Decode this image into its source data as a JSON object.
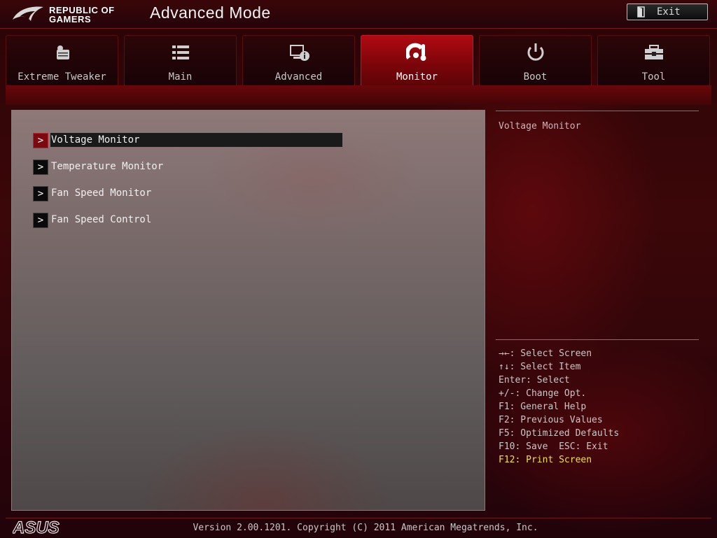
{
  "header": {
    "brand_line1": "REPUBLIC OF",
    "brand_line2": "GAMERS",
    "mode_title": "Advanced Mode",
    "exit_label": "Exit"
  },
  "tabs": [
    {
      "label": "Extreme Tweaker",
      "icon": "tweaker-icon",
      "active": false
    },
    {
      "label": "Main",
      "icon": "list-icon",
      "active": false
    },
    {
      "label": "Advanced",
      "icon": "advanced-info-icon",
      "active": false
    },
    {
      "label": "Monitor",
      "icon": "thermometer-gauge-icon",
      "active": true
    },
    {
      "label": "Boot",
      "icon": "power-icon",
      "active": false
    },
    {
      "label": "Tool",
      "icon": "toolbox-icon",
      "active": false
    }
  ],
  "menu": {
    "items": [
      {
        "label": "Voltage Monitor",
        "selected": true
      },
      {
        "label": "Temperature Monitor",
        "selected": false
      },
      {
        "label": "Fan Speed Monitor",
        "selected": false
      },
      {
        "label": "Fan Speed Control",
        "selected": false
      }
    ]
  },
  "help": {
    "title": "Voltage Monitor",
    "keys": [
      "→←: Select Screen",
      "↑↓: Select Item",
      "Enter: Select",
      "+/-: Change Opt.",
      "F1: General Help",
      "F2: Previous Values",
      "F5: Optimized Defaults",
      "F10: Save  ESC: Exit",
      "F12: Print Screen"
    ]
  },
  "footer": {
    "brand": "ASUS",
    "version": "Version 2.00.1201. Copyright (C) 2011 American Megatrends, Inc."
  },
  "colors": {
    "accent_red": "#b00a12",
    "highlight_yellow": "#f0e040"
  }
}
